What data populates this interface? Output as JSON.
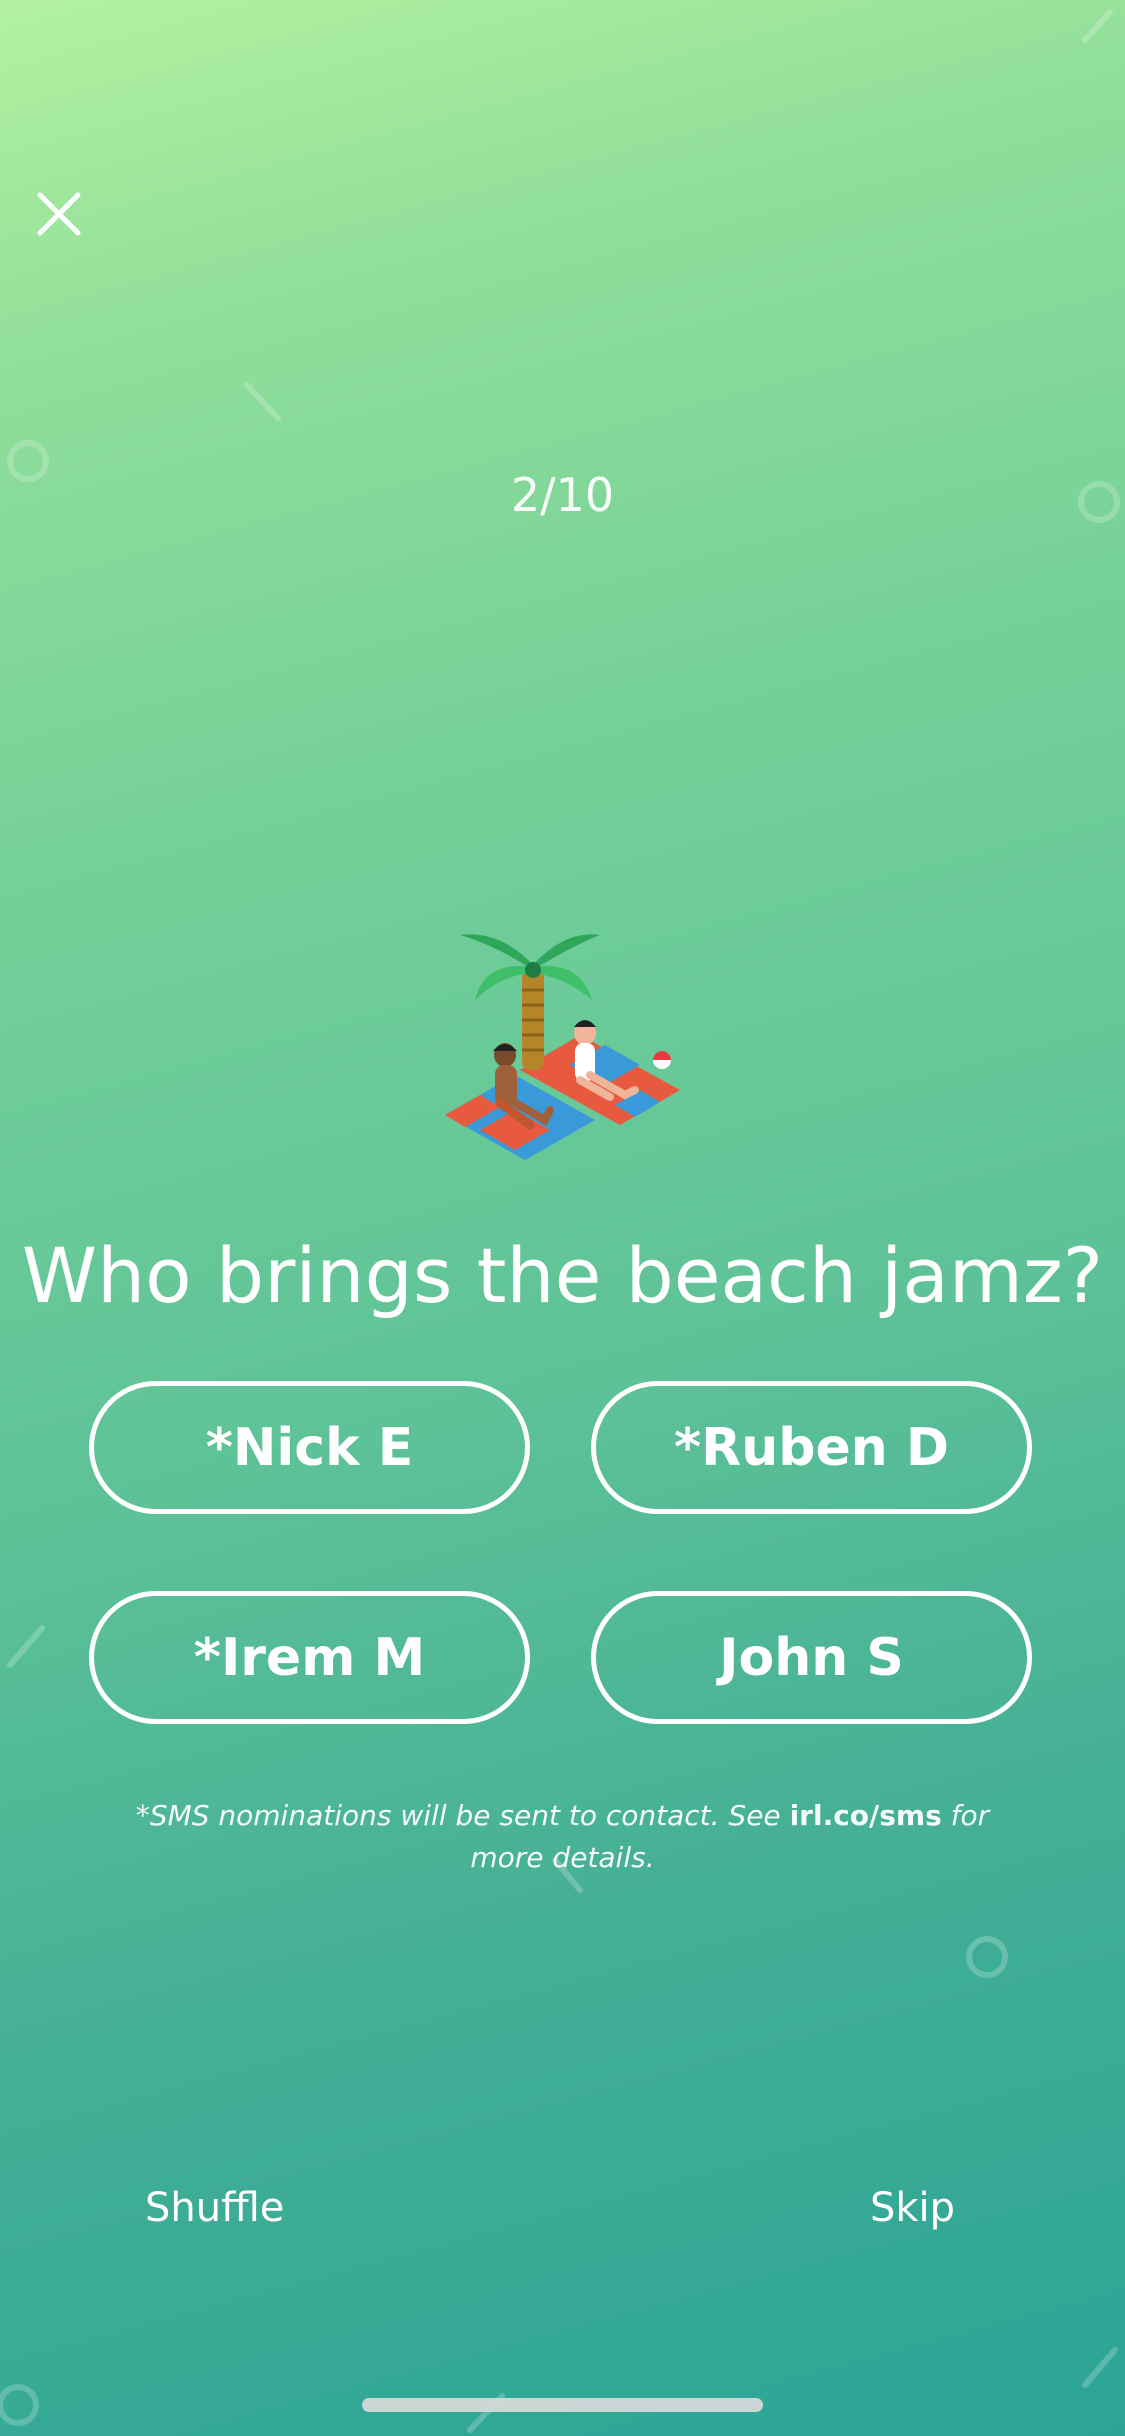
{
  "header": {
    "close_icon": "close-icon",
    "progress": "2/10"
  },
  "question": {
    "text": "Who brings the beach jamz?",
    "illustration": "beach-palm-tree-illustration"
  },
  "choices": [
    {
      "label": "*Nick E"
    },
    {
      "label": "*Ruben D"
    },
    {
      "label": "*Irem M"
    },
    {
      "label": "John S"
    }
  ],
  "disclaimer": {
    "prefix": "*SMS nominations will be sent to contact. See ",
    "link": "irl.co/sms",
    "suffix": " for more details."
  },
  "footer": {
    "shuffle_label": "Shuffle",
    "skip_label": "Skip"
  },
  "colors": {
    "gradient_top": "#b3f1a0",
    "gradient_bottom": "#2ba496",
    "text": "#ffffff"
  }
}
